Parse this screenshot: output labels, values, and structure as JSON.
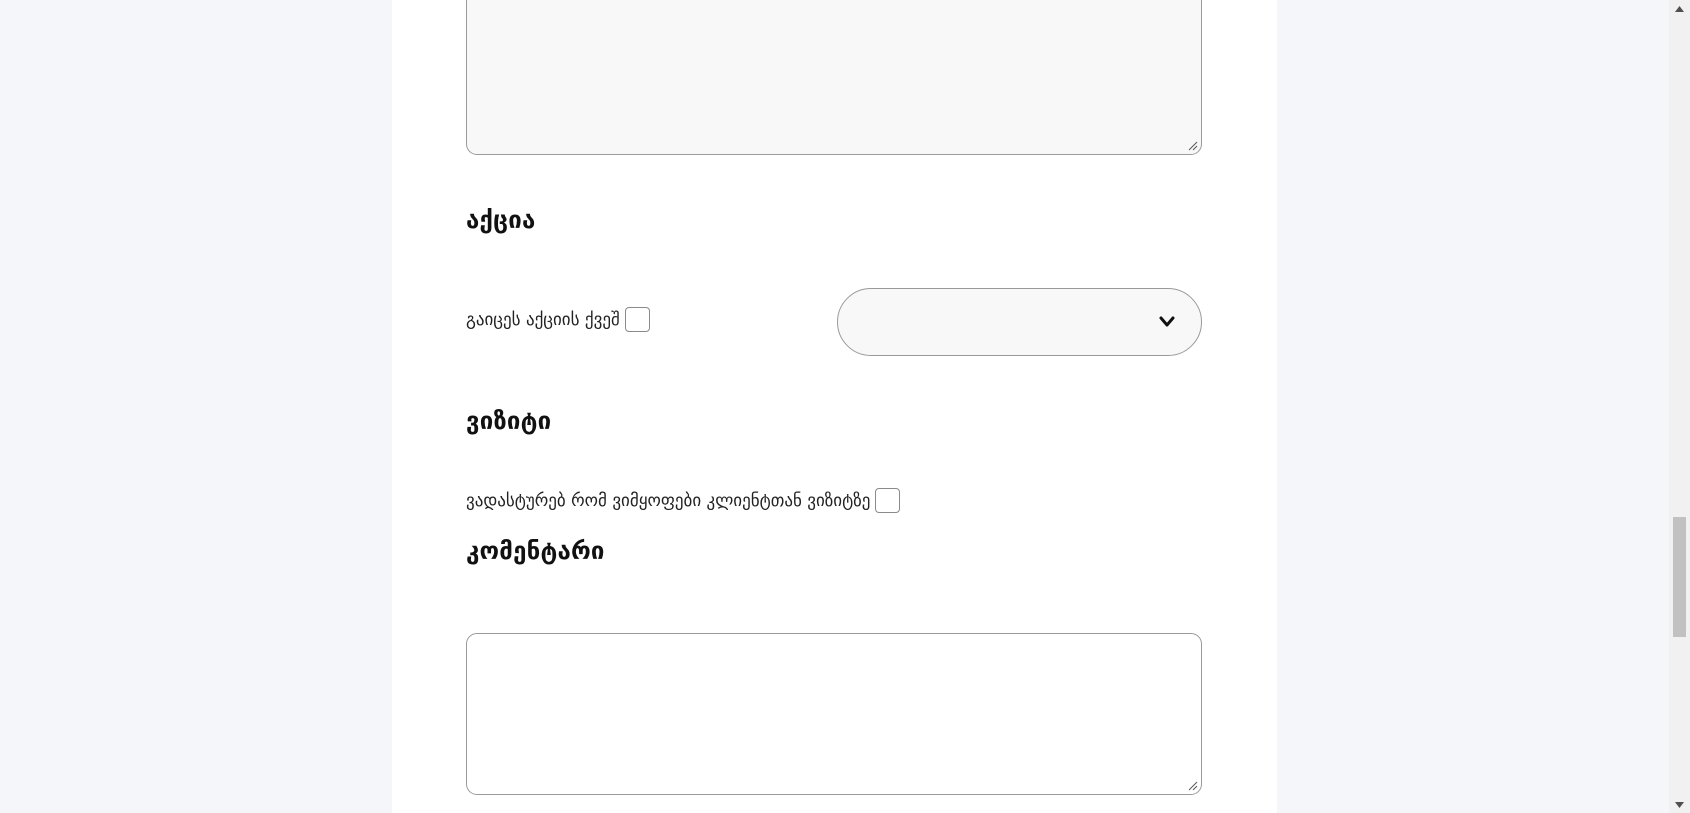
{
  "form": {
    "promo_section": {
      "title": "აქცია",
      "checkbox_label": "გაიცეს აქციის ქვეშ",
      "checkbox_checked": false,
      "select_value": "",
      "select_icon": "chevron-down-icon"
    },
    "visit_section": {
      "title": "ვიზიტი",
      "checkbox_label": "ვადასტურებ რომ ვიმყოფები კლიენტთან ვიზიტზე",
      "checkbox_checked": false
    },
    "comment_section": {
      "title": "კომენტარი",
      "textarea_value": ""
    },
    "previous_textarea_value": ""
  },
  "colors": {
    "page_background": "#f4f6f9",
    "card_background": "#ffffff",
    "field_border": "#9a9a9a",
    "field_background": "#f8f8f8",
    "text": "#111111"
  },
  "scrollbar": {
    "up_icon": "triangle-up-icon",
    "down_icon": "triangle-down-icon"
  }
}
